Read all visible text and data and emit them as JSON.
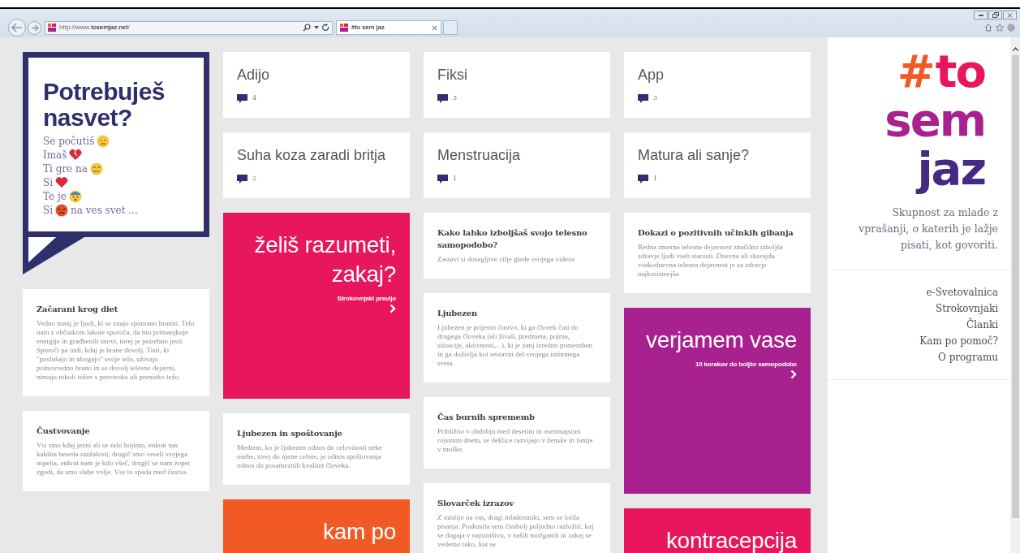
{
  "browser": {
    "url_prefix": "http://www.",
    "url_domain": "tosemjaz.net",
    "url_suffix": "/",
    "tab_title": "#to sem jaz"
  },
  "columns": [
    {
      "items": [
        {
          "kind": "bubble",
          "title": "Potrebuješ nasvet?",
          "lines": [
            {
              "before": "Se počutiš",
              "kind": "sad"
            },
            {
              "before": "Imaš",
              "kind": "broken-heart"
            },
            {
              "before": "Ti gre na",
              "kind": "crying"
            },
            {
              "before": "Si",
              "kind": "heart"
            },
            {
              "before": "Te je",
              "kind": "scared"
            },
            {
              "before": "Si",
              "kind": "angry",
              "after": "na ves svet ..."
            }
          ]
        },
        {
          "kind": "article",
          "title": "Začarani krog diet",
          "text": "Vedno manj je ljudi, ki se znajo spontano hraniti. Telo nam z občutkom lakote sporoča, da mu primanjkuje energije in gradbenih snovi, torej je potrebno jesti. Sporoči pa tudi, kdaj je hrane dovolj. Tisti, ki \"poslušajo in ubogajo\" svoje telo, uživajo polnovredno hrano in so dovolj telesno dejavni, nimajo nikoli težav s previsoko ali prenizko težo."
        },
        {
          "kind": "article",
          "title": "Čustvovanje",
          "text": "Vsi smo kdaj jezni ali se zelo bojimo, enkrat nas kakšna beseda razžalosti, drugič smo veseli svojega uspeha, enkrat nam je kdo všeč, drugič se nam zopet zgodi, da smo slabe volje. Vse to spada med čustva."
        }
      ]
    },
    {
      "items": [
        {
          "kind": "tile",
          "title": "Adijo",
          "count": "4"
        },
        {
          "kind": "tile",
          "title": "Suha koza zaradi britja",
          "count": "2"
        },
        {
          "kind": "promo",
          "color": "#e8175d",
          "headline": "želiš razumeti, zakaj?",
          "subtitle": "Strokovnjaki pravijo"
        },
        {
          "kind": "article",
          "title": "Ljubezen in spoštovanje",
          "text": "Medtem, ko je ljubezen odnos do celovitosti neke osebe, torej do njene celote, je odnos spoštovanja odnos do posameznih kvalitet človeka."
        },
        {
          "kind": "promo",
          "color": "#f15a24",
          "headline": "kam po"
        }
      ]
    },
    {
      "items": [
        {
          "kind": "tile",
          "title": "Fiksi",
          "count": "3"
        },
        {
          "kind": "tile",
          "title": "Menstruacija",
          "count": "1"
        },
        {
          "kind": "article",
          "title": "Kako lahko izboljšaš svojo telesno samopodobo?",
          "text": "Zastavi si dosegljive cilje glede svojega videza"
        },
        {
          "kind": "article",
          "title": "Ljubezen",
          "text": "Ljubezen je prijetno čustvo, ki ga človek čuti do drugega človeka (ali živali, predmeta, pojma, situacije, aktivnosti,...), ki je zanj izredno pomemben in ga doživlja kot sestavni del svojega intimnega sveta."
        },
        {
          "kind": "article",
          "title": "Čas burnih sprememb",
          "text": "Približno v obdobju med desetim in osemnajstim rojstnim dnem, se deklice razvijajo v ženske in fantje v moške."
        },
        {
          "kind": "article",
          "title": "Slovarček izrazov",
          "text": "Z mislijo na vas, dragi mladostniki, sem se lotila pisanja. Poskusila sem čimbolj poljudno razložiti, kaj se dogaja v najstništvu, v naših možganih in zakaj se vedemo tako, kot se"
        }
      ]
    },
    {
      "items": [
        {
          "kind": "tile",
          "title": "App",
          "count": "3"
        },
        {
          "kind": "tile",
          "title": "Matura ali sanje?",
          "count": "1"
        },
        {
          "kind": "article",
          "title": "Dokazi o pozitivnih učinkih gibanja",
          "text": "Redna zmerna telesna dejavnost značilno izboljša zdravje ljudi vseh starosti. Dnevna ali skorajda vsakodnevna telesna dejavnost je za zdravje najkoristnejša."
        },
        {
          "kind": "promo",
          "color": "#a8218e",
          "headline": "verjamem vase",
          "subtitle": "10 korakov do boljše samopodobe"
        },
        {
          "kind": "promo",
          "color": "#e8175d",
          "headline": "kontracepcija"
        }
      ]
    }
  ],
  "sidebar": {
    "logo": [
      {
        "parts": [
          {
            "text": "#",
            "color": "#f15a24"
          },
          {
            "text": "to",
            "color": "#e8175d"
          }
        ]
      },
      {
        "parts": [
          {
            "text": "sem",
            "color": "#a8218e"
          }
        ]
      },
      {
        "parts": [
          {
            "text": "jaz",
            "color": "#452a84"
          }
        ]
      }
    ],
    "tagline": "Skupnost za mlade z vprašanji, o katerih je lažje pisati, kot govoriti.",
    "nav": [
      "e-Svetovalnica",
      "Strokovnjaki",
      "Članki",
      "Kam po pomoč?",
      "O programu"
    ]
  }
}
